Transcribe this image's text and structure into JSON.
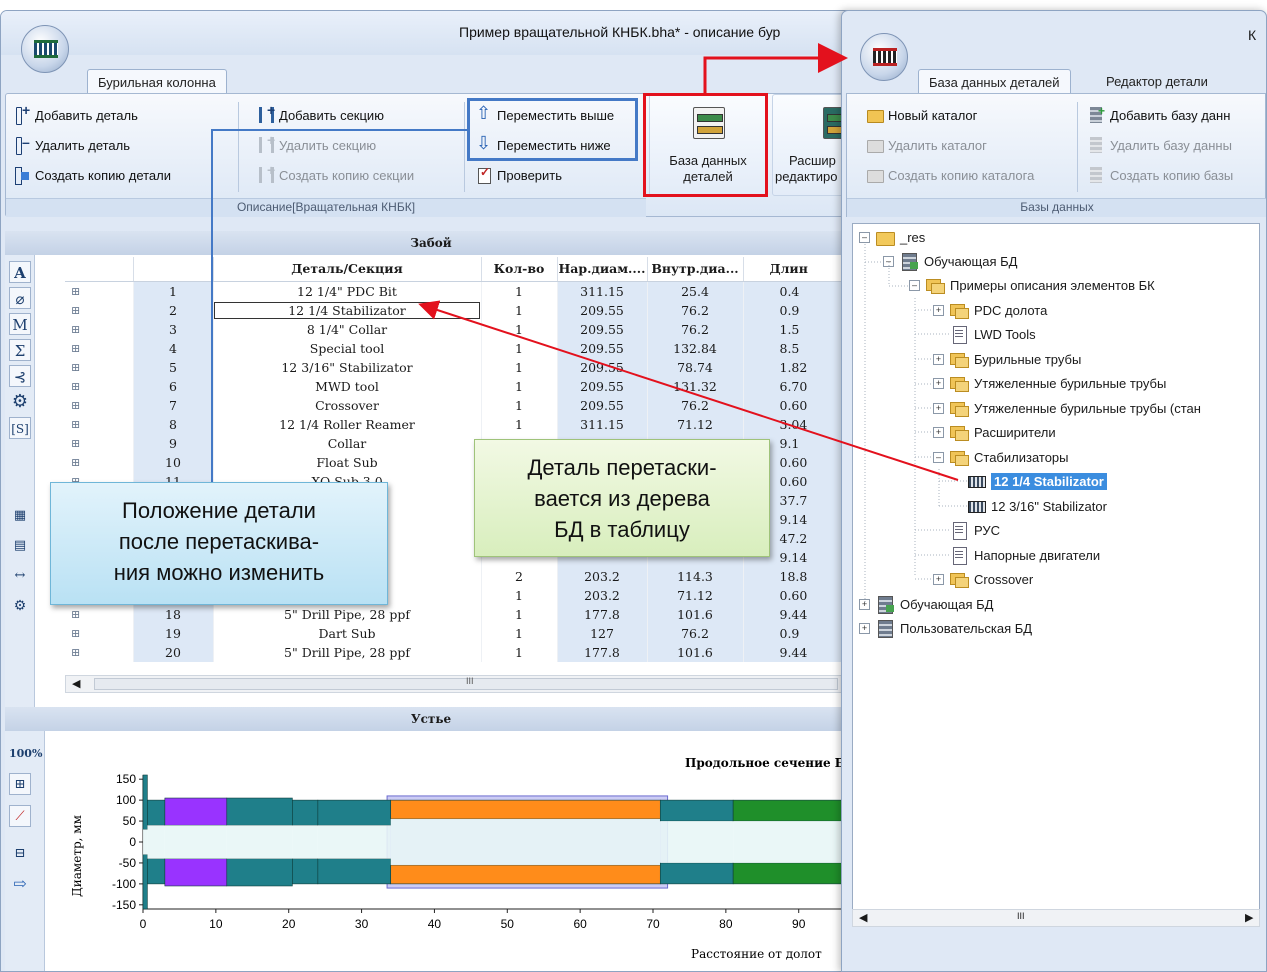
{
  "main_window": {
    "title": "Пример вращательной КНБК.bha* - описание бур",
    "ribbon_tab": "Бурильная колонна",
    "buttons": {
      "add_part": "Добавить деталь",
      "delete_part": "Удалить деталь",
      "copy_part": "Создать копию детали",
      "add_section": "Добавить секцию",
      "delete_section": "Удалить секцию",
      "copy_section": "Создать копию секции",
      "move_up": "Переместить выше",
      "move_down": "Переместить ниже",
      "check": "Проверить",
      "parts_db_line1": "База данных",
      "parts_db_line2": "деталей",
      "expander_line1": "Расшир",
      "expander_line2": "редактиро"
    },
    "group_label": "Описание[Вращательная КНБК]",
    "band_top": "Забой",
    "band_bottom": "Устье",
    "left_tools": [
      "A",
      "M",
      "Σ",
      "[S]"
    ],
    "chart_tools": [
      "100%"
    ],
    "grid": {
      "columns": [
        "Деталь/Секция",
        "Кол-во",
        "Нар.диам....",
        "Внутр.диа...",
        "Длин"
      ],
      "rows": [
        {
          "n": "1",
          "name": "12 1/4\" PDC Bit",
          "qty": "1",
          "od": "311.15",
          "id": "25.4",
          "len": "0.4"
        },
        {
          "n": "2",
          "name": "12 1/4 Stabilizator",
          "qty": "1",
          "od": "209.55",
          "id": "76.2",
          "len": "0.9"
        },
        {
          "n": "3",
          "name": "8 1/4\" Collar",
          "qty": "1",
          "od": "209.55",
          "id": "76.2",
          "len": "1.5"
        },
        {
          "n": "4",
          "name": "Special tool",
          "qty": "1",
          "od": "209.55",
          "id": "132.84",
          "len": "8.5"
        },
        {
          "n": "5",
          "name": "12 3/16\" Stabilizator",
          "qty": "1",
          "od": "209.55",
          "id": "78.74",
          "len": "1.82"
        },
        {
          "n": "6",
          "name": "MWD tool",
          "qty": "1",
          "od": "209.55",
          "id": "131.32",
          "len": "6.70"
        },
        {
          "n": "7",
          "name": "Crossover",
          "qty": "1",
          "od": "209.55",
          "id": "76.2",
          "len": "0.60"
        },
        {
          "n": "8",
          "name": "12 1/4 Roller Reamer",
          "qty": "1",
          "od": "311.15",
          "id": "71.12",
          "len": "3.04"
        },
        {
          "n": "9",
          "name": "Collar",
          "qty": "1",
          "od": "203.2",
          "id": "71.12",
          "len": "9.1"
        },
        {
          "n": "10",
          "name": "Float Sub",
          "qty": "",
          "od": "",
          "id": "",
          "len": "0.60"
        },
        {
          "n": "11",
          "name": "XO Sub 3.0",
          "qty": "",
          "od": "",
          "id": "",
          "len": "0.60"
        },
        {
          "n": "",
          "name": "P",
          "qty": "",
          "od": "",
          "id": "",
          "len": "37.7"
        },
        {
          "n": "",
          "name": "",
          "qty": "",
          "od": "",
          "id": "",
          "len": "9.14"
        },
        {
          "n": "",
          "name": "P",
          "qty": "",
          "od": "",
          "id": "",
          "len": "47.2"
        },
        {
          "n": "",
          "name": "",
          "qty": "",
          "od": "",
          "id": "",
          "len": "9.14"
        },
        {
          "n": "",
          "name": "P",
          "qty": "2",
          "od": "203.2",
          "id": "114.3",
          "len": "18.8"
        },
        {
          "n": "",
          "name": "",
          "qty": "1",
          "od": "203.2",
          "id": "71.12",
          "len": "0.60"
        },
        {
          "n": "18",
          "name": "5\" Drill Pipe, 28 ppf",
          "qty": "1",
          "od": "177.8",
          "id": "101.6",
          "len": "9.44"
        },
        {
          "n": "19",
          "name": "Dart Sub",
          "qty": "1",
          "od": "127",
          "id": "76.2",
          "len": "0.9"
        },
        {
          "n": "20",
          "name": "5\" Drill Pipe, 28 ppf",
          "qty": "1",
          "od": "177.8",
          "id": "101.6",
          "len": "9.44"
        }
      ]
    },
    "hscroll_label": "III"
  },
  "chart_data": {
    "type": "area",
    "title": "Продольное сечение БК",
    "xlabel": "Расстояние от долот",
    "ylabel": "Диаметр, мм",
    "x_ticks": [
      "0",
      "10",
      "20",
      "30",
      "40",
      "50",
      "60",
      "70",
      "80",
      "90"
    ],
    "y_ticks": [
      "150",
      "100",
      "50",
      "0",
      "-50",
      "-100",
      "-150"
    ],
    "xlim": [
      0,
      98
    ],
    "ylim": [
      -160,
      160
    ],
    "sections": [
      {
        "x0": 0,
        "x1": 0.6,
        "od": 160,
        "id": 30,
        "color": "#1f7f8a"
      },
      {
        "x0": 0.6,
        "x1": 3.0,
        "od": 100,
        "id": 40,
        "color": "#1f7f8a"
      },
      {
        "x0": 3.0,
        "x1": 11.5,
        "od": 105,
        "id": 40,
        "color": "#9933ff"
      },
      {
        "x0": 11.5,
        "x1": 20.5,
        "od": 105,
        "id": 40,
        "color": "#1f7f8a"
      },
      {
        "x0": 20.5,
        "x1": 24.0,
        "od": 100,
        "id": 40,
        "color": "#1f7f8a"
      },
      {
        "x0": 24.0,
        "x1": 34.0,
        "od": 100,
        "id": 40,
        "color": "#1f7f8a"
      },
      {
        "x0": 34.0,
        "x1": 71.0,
        "od": 100,
        "id": 55,
        "color": "#ff8c1a"
      },
      {
        "x0": 71.0,
        "x1": 81.0,
        "od": 100,
        "id": 50,
        "color": "#1f7f8a"
      },
      {
        "x0": 81.0,
        "x1": 98.0,
        "od": 100,
        "id": 50,
        "color": "#1f8f2a"
      }
    ],
    "highlight_range": [
      33.5,
      72.0
    ]
  },
  "db_window": {
    "title": "К",
    "tabs": [
      "База данных деталей",
      "Редактор детали"
    ],
    "buttons": {
      "new_catalog": "Новый каталог",
      "delete_catalog": "Удалить каталог",
      "copy_catalog": "Создать копию каталога",
      "add_db": "Добавить базу данн",
      "delete_db": "Удалить базу данны",
      "copy_db": "Создать копию базы"
    },
    "group_label": "Базы данных",
    "tree": {
      "root": "_res",
      "training_db": "Обучающая БД",
      "examples": "Примеры описания элементов БК",
      "pdc": "PDC долота",
      "lwd": "LWD Tools",
      "drill_pipes": "Бурильные трубы",
      "heavy_pipes": "Утяжеленные бурильные трубы",
      "heavy_pipes_std": "Утяжеленные бурильные трубы (стан",
      "reamers": "Расширители",
      "stabilizers": "Стабилизаторы",
      "stab_1": "12 1/4 Stabilizator",
      "stab_2": "12 3/16\" Stabilizator",
      "rus": "РУС",
      "motors": "Напорные двигатели",
      "crossover": "Crossover",
      "training_db_2": "Обучающая БД",
      "user_db": "Пользовательская БД"
    },
    "hscroll_label": "III"
  },
  "annotations": {
    "drag_callout": [
      "Деталь перетаски-",
      "вается из дерева",
      "БД в таблицу"
    ],
    "position_callout": [
      "Положение детали",
      "после перетаскива-",
      "ния можно изменить"
    ]
  },
  "colors": {
    "highlight_red": "#e3111d",
    "highlight_blue": "#4479c6",
    "selection_blue": "#3b8ddf"
  }
}
